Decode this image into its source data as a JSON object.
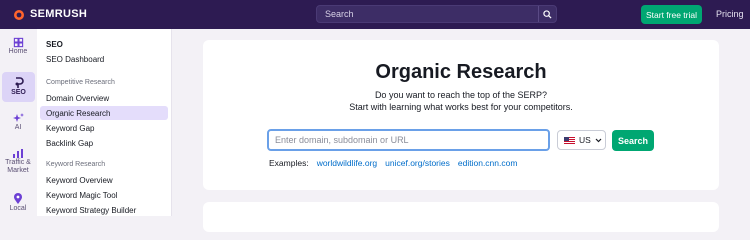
{
  "header": {
    "brand": "SEMRUSH",
    "search_placeholder": "Search",
    "trial_label": "Start free trial",
    "pricing_label": "Pricing"
  },
  "rail": [
    {
      "label": "Home",
      "icon": "home-icon"
    },
    {
      "label": "SEO",
      "icon": "seo-icon",
      "active": true
    },
    {
      "label": "AI",
      "icon": "ai-sparkle-icon"
    },
    {
      "label": "Traffic & Market",
      "icon": "traffic-chart-icon"
    },
    {
      "label": "Local",
      "icon": "location-pin-icon"
    }
  ],
  "menu": {
    "heading": "SEO",
    "dashboard": "SEO Dashboard",
    "section1": "Competitive Research",
    "items1": [
      "Domain Overview",
      "Organic Research",
      "Keyword Gap",
      "Backlink Gap"
    ],
    "section2": "Keyword Research",
    "items2": [
      "Keyword Overview",
      "Keyword Magic Tool",
      "Keyword Strategy Builder"
    ]
  },
  "main": {
    "title": "Organic Research",
    "subtitle1": "Do you want to reach the top of the SERP?",
    "subtitle2": "Start with learning what works best for your competitors.",
    "input_placeholder": "Enter domain, subdomain or URL",
    "database": "US",
    "search_label": "Search",
    "examples_label": "Examples:",
    "examples": [
      "worldwildlife.org",
      "unicef.org/stories",
      "edition.cnn.com"
    ]
  },
  "colors": {
    "topbar": "#2d1b52",
    "accent_green": "#00a772",
    "accent_purple": "#6c40d4",
    "link": "#006dca"
  }
}
